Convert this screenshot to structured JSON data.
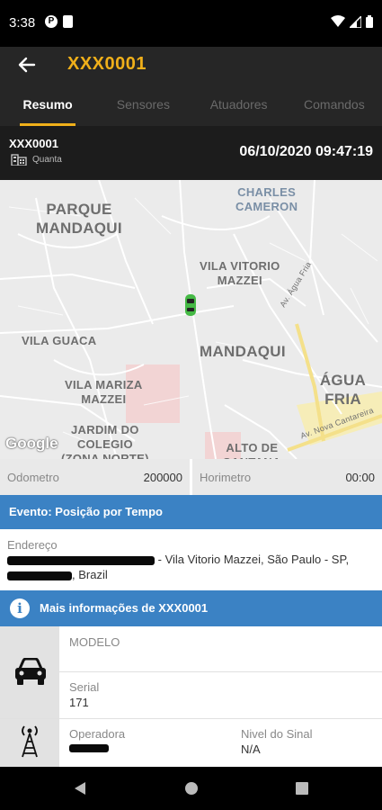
{
  "status_bar": {
    "time": "3:38",
    "icons": [
      "notification-app-icon",
      "sd-card-icon",
      "wifi-icon",
      "signal-icon",
      "battery-icon"
    ]
  },
  "app_bar": {
    "title": "XXX0001",
    "back_icon": "arrow-left-icon",
    "accent_color": "#f0b01a"
  },
  "tabs": [
    {
      "label": "Resumo",
      "active": true
    },
    {
      "label": "Sensores",
      "active": false
    },
    {
      "label": "Atuadores",
      "active": false
    },
    {
      "label": "Comandos",
      "active": false
    }
  ],
  "vehicle": {
    "plate": "XXX0001",
    "location_label": "Quanta",
    "datetime": "06/10/2020 09:47:19"
  },
  "map": {
    "labels": [
      "PARQUE MANDAQUI",
      "CHARLES CAMERON",
      "VILA VITORIO MAZZEI",
      "VILA GUACA",
      "MANDAQUI",
      "ÁGUA FRIA",
      "VILA MARIZA MAZZEI",
      "JARDIM DO COLEGIO (ZONA NORTE)",
      "ALTO DE SANTANA",
      "Av. Água Fria",
      "Av. Nova Cantareira"
    ],
    "attribution": "Google"
  },
  "stats": {
    "odometer_label": "Odometro",
    "odometer_value": "200000",
    "hourmeter_label": "Horimetro",
    "hourmeter_value": "00:00"
  },
  "event": {
    "text": "Evento: Posição por Tempo"
  },
  "address": {
    "label": "Endereço",
    "line1_visible": "- Vila Vitorio Mazzei, São Paulo - SP,",
    "line2_visible": ", Brazil"
  },
  "more_info": {
    "text": "Mais informações de XXX0001",
    "icon": "info-icon"
  },
  "details": {
    "model_label": "MODELO",
    "model_value": "",
    "serial_label": "Serial",
    "serial_value": "171",
    "operator_label": "Operadora",
    "signal_label": "Nivel do Sinal",
    "signal_value": "N/A",
    "vehicle_icon": "car-icon",
    "antenna_icon": "antenna-icon"
  },
  "colors": {
    "blue_bar": "#3b82c4",
    "dark_bar": "#1c1c1c"
  }
}
